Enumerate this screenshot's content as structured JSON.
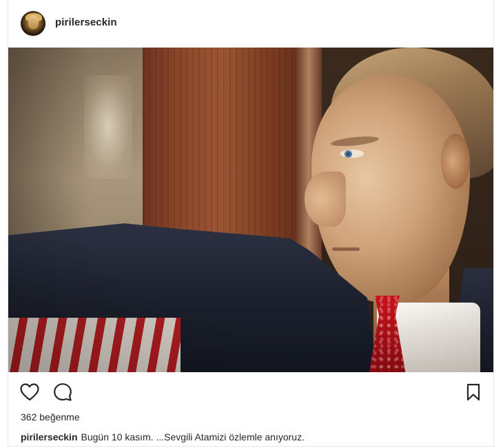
{
  "post": {
    "username": "pirilerseckin",
    "likes_text": "362 beğenme",
    "caption": {
      "username": "pirilerseckin",
      "text": "Bugün 10 kasım. ...Sevgili Atamizi özlemle anıyoruz."
    },
    "icons": {
      "like": "heart-icon",
      "comment": "comment-bubble-icon",
      "save": "bookmark-icon"
    }
  }
}
